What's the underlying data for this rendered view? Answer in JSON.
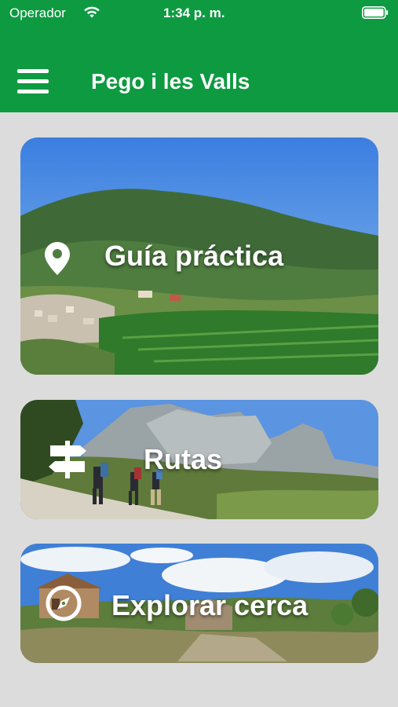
{
  "status_bar": {
    "carrier": "Operador",
    "time": "1:34 p. m."
  },
  "header": {
    "title": "Pego i les Valls",
    "menu_icon": "hamburger-menu-icon"
  },
  "cards": [
    {
      "label": "Guía práctica",
      "icon": "map-pin-icon"
    },
    {
      "label": "Rutas",
      "icon": "signpost-icon"
    },
    {
      "label": "Explorar cerca",
      "icon": "compass-icon"
    }
  ],
  "colors": {
    "header_bg": "#0e9a41",
    "page_bg": "#dcdcdc"
  }
}
